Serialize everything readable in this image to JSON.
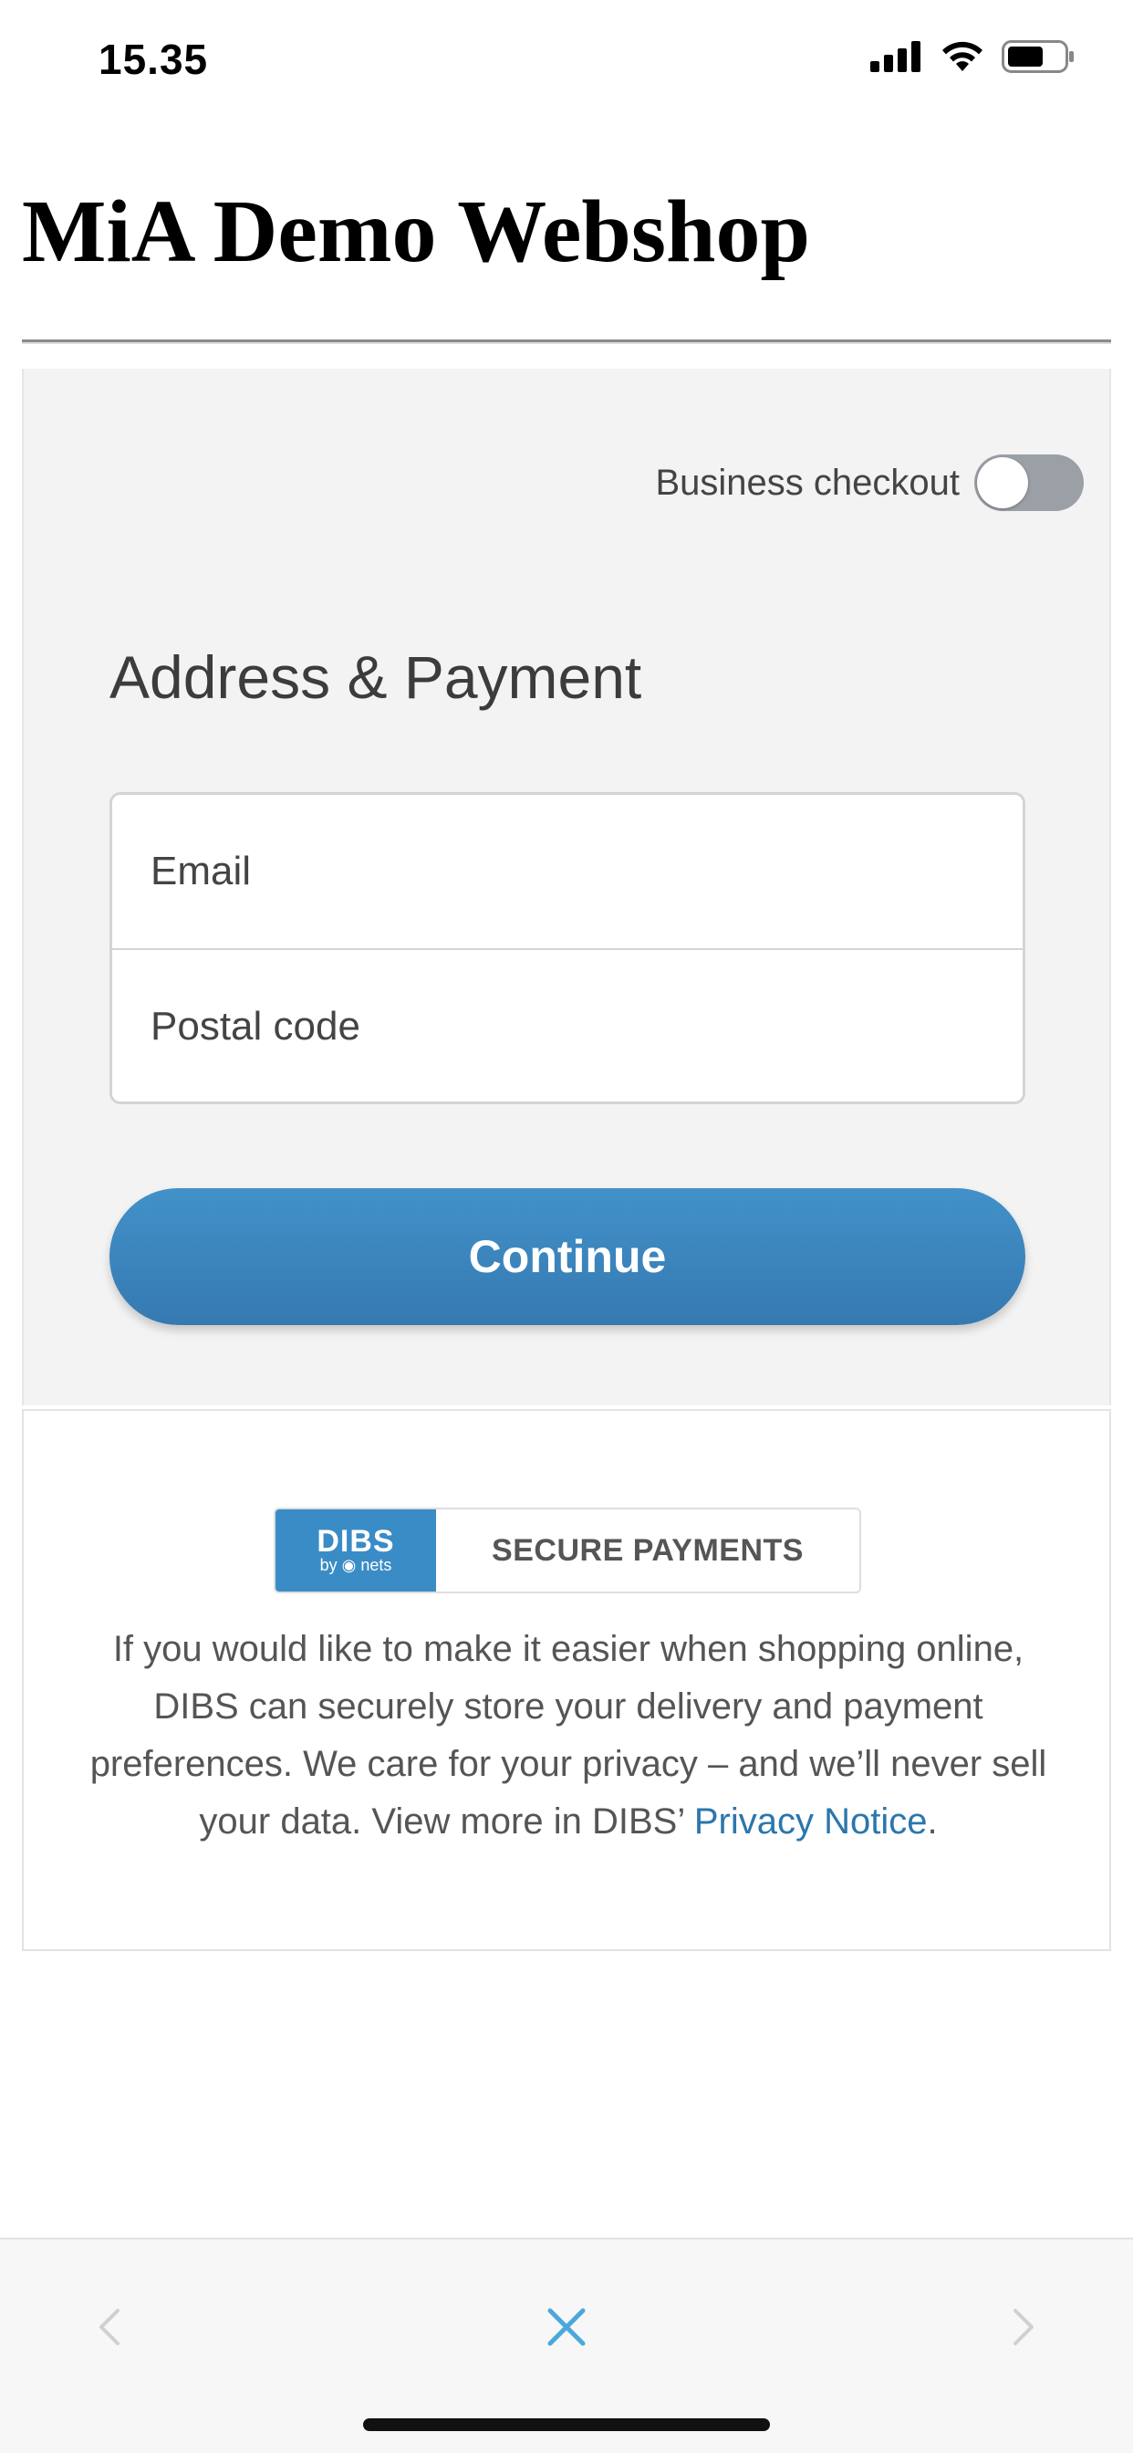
{
  "status_bar": {
    "time": "15.35",
    "icons": [
      "cellular-signal-icon",
      "wifi-icon",
      "battery-icon"
    ]
  },
  "page": {
    "title": "MiA Demo Webshop"
  },
  "checkout": {
    "business_checkout_label": "Business checkout",
    "business_checkout_enabled": false,
    "section_heading": "Address & Payment",
    "email_placeholder": "Email",
    "postal_code_placeholder": "Postal code",
    "continue_label": "Continue"
  },
  "dibs": {
    "logo_text": "DIBS",
    "logo_subtext": "by ◉ nets",
    "secure_label": "SECURE PAYMENTS",
    "info_text": "If you would like to make it easier when shopping online, DIBS can securely store your delivery and payment preferences. We care for your privacy – and we’ll never sell your data. View more in DIBS’ ",
    "privacy_link": "Privacy Notice",
    "info_text_end": "."
  },
  "toolbar": {
    "icons": [
      "chevron-left-icon",
      "close-icon",
      "chevron-right-icon"
    ]
  },
  "colors": {
    "accent": "#3a86c0",
    "link": "#2b76ad",
    "panel_background": "#f3f3f3",
    "toggle_off": "#9aa0a6",
    "close_icon": "#4aa8dc"
  }
}
